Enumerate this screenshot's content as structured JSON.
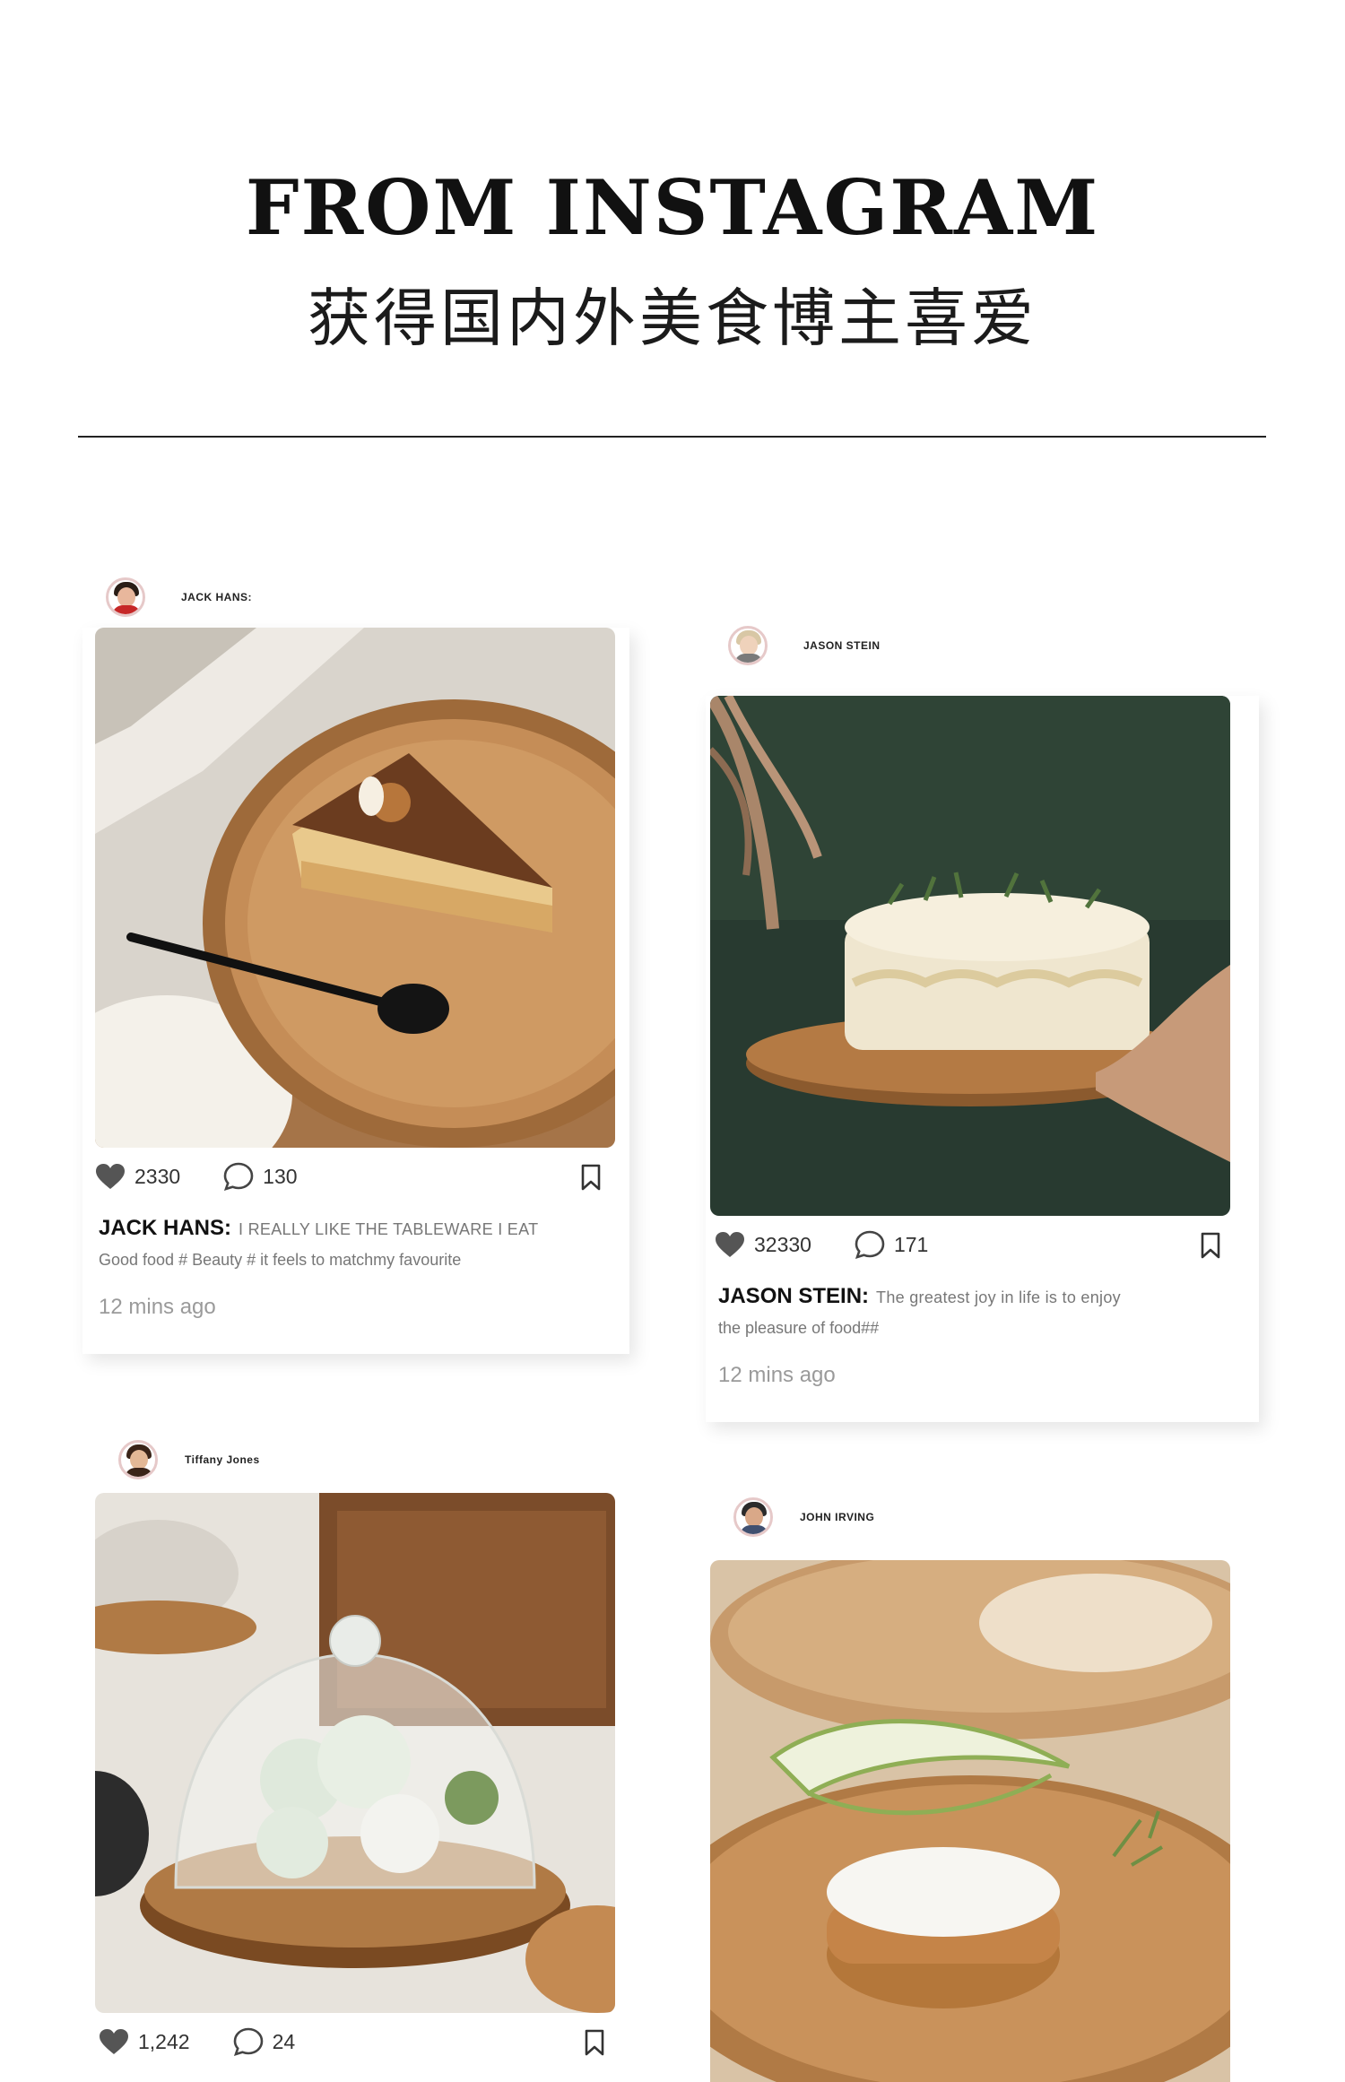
{
  "header": {
    "title_en": "FROM INSTAGRAM",
    "title_cn": "获得国内外美食博主喜爱"
  },
  "posts": [
    {
      "username": "JACK HANS:",
      "likes": "2330",
      "comments": "130",
      "caption_author": "JACK HANS:",
      "caption_line1": "I REALLY LIKE THE TABLEWARE I EAT",
      "caption_line2": "Good food # Beauty #   it feels to matchmy favourite",
      "time": "12 mins ago"
    },
    {
      "username": "JASON STEIN",
      "likes": "32330",
      "comments": "171",
      "caption_author": "JASON STEIN:",
      "caption_line1": "The greatest joy in life is to enjoy",
      "caption_line2": "the pleasure of food##",
      "time": "12 mins ago"
    },
    {
      "username": "Tiffany Jones",
      "likes": "1,242",
      "comments": "24"
    },
    {
      "username": "JOHN IRVING"
    }
  ],
  "icons": {
    "like": "heart-icon",
    "comment": "comment-bubble-icon",
    "save": "bookmark-icon"
  },
  "colors": {
    "wood": "#b07a45",
    "wood_dark": "#7a4a22",
    "green_backdrop": "#2b3b30",
    "icon_gray": "#555555"
  }
}
